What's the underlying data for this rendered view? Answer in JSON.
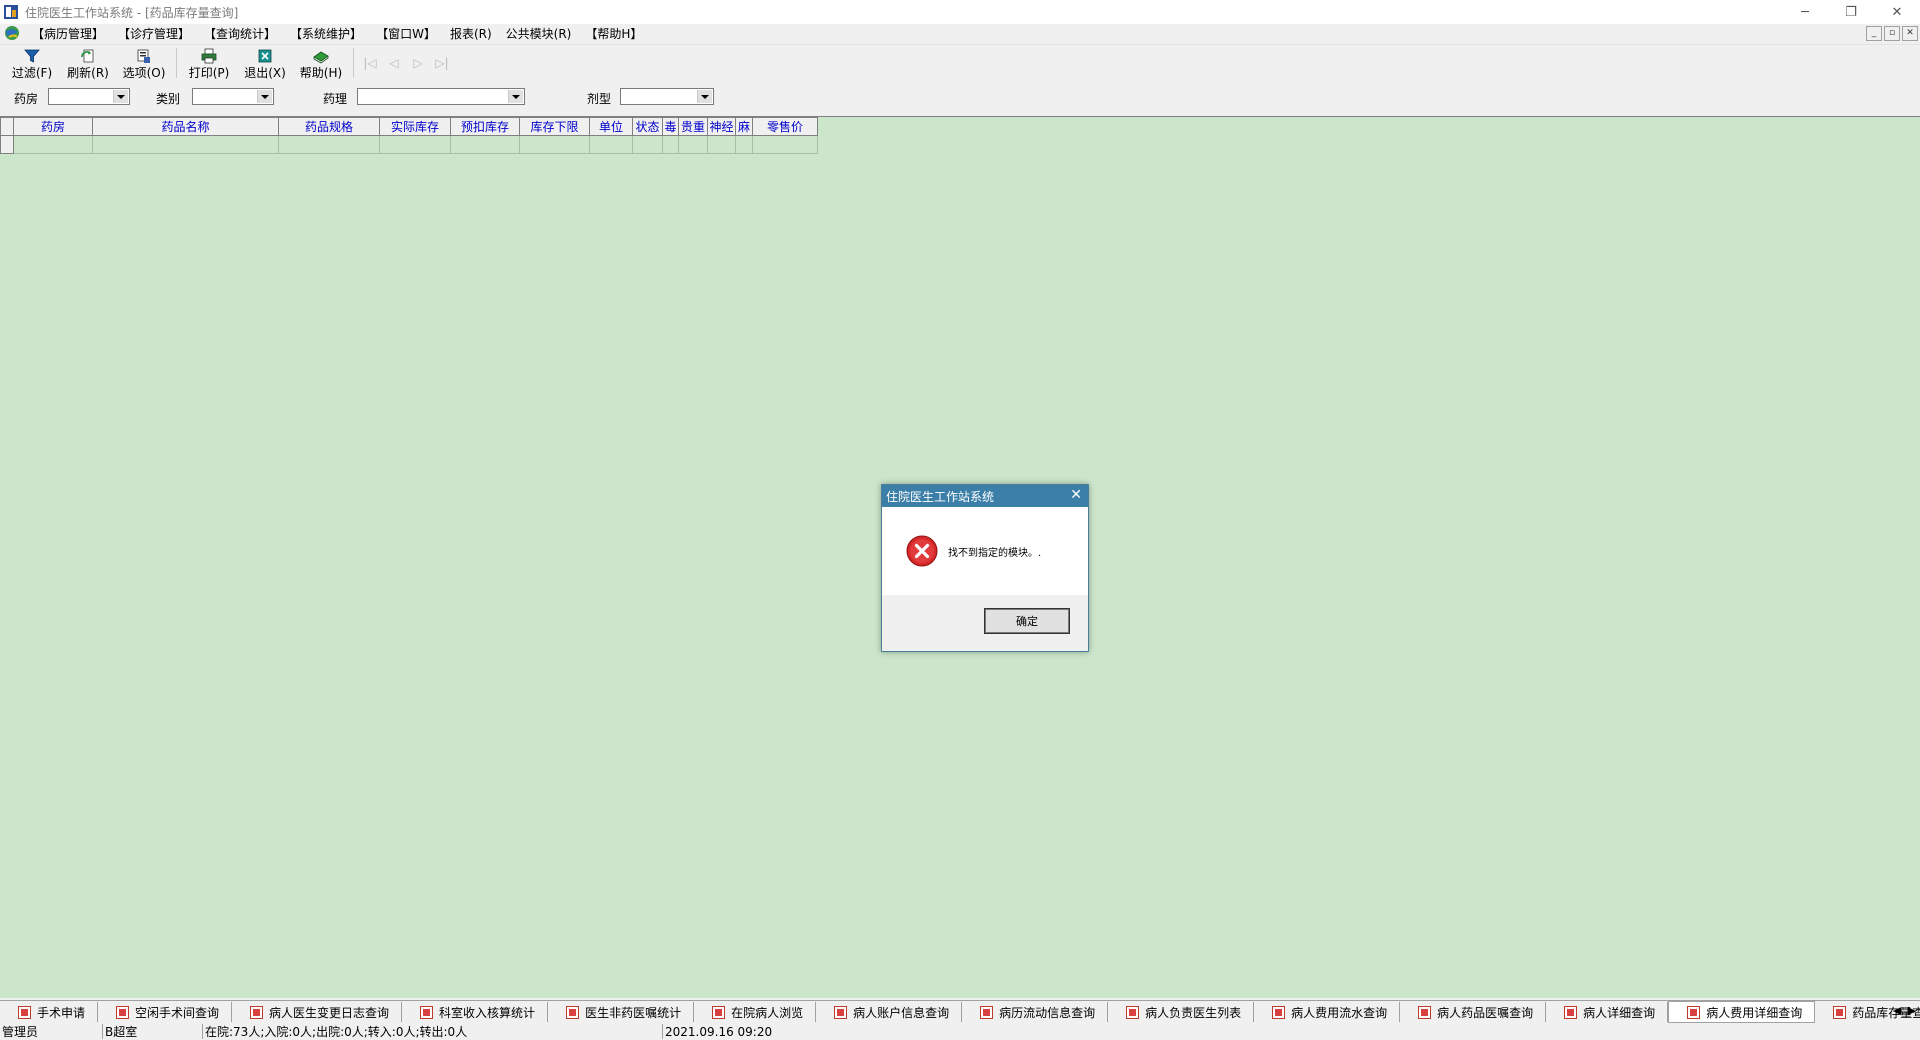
{
  "window": {
    "title": "住院医生工作站系统 - [药品库存量查询]",
    "minimize": "─",
    "restore": "❐",
    "close": "✕"
  },
  "menu": {
    "items": [
      "【病历管理】",
      "【诊疗管理】",
      "【查询统计】",
      "【系统维护】",
      "【窗口W】",
      "报表(R)",
      "公共模块(R)",
      "【帮助H】"
    ],
    "mdi": [
      "_",
      "▫",
      "✕"
    ]
  },
  "toolbar": {
    "filter": "过滤(F)",
    "refresh": "刷新(R)",
    "options": "选项(O)",
    "print": "打印(P)",
    "exit": "退出(X)",
    "help": "帮助(H)",
    "nav": [
      "|◁",
      "◁",
      "▷",
      "▷|"
    ]
  },
  "filters": {
    "pharmacy_label": "药房",
    "category_label": "类别",
    "pharmacology_label": "药理",
    "dosage_form_label": "剂型"
  },
  "grid": {
    "columns": [
      "药房",
      "药品名称",
      "药品规格",
      "实际库存",
      "预扣库存",
      "库存下限",
      "单位",
      "状态",
      "毒",
      "贵重",
      "神经",
      "麻",
      "零售价"
    ]
  },
  "dialog": {
    "title": "住院医生工作站系统",
    "close": "✕",
    "message": "找不到指定的模块。.",
    "ok": "确定"
  },
  "taskbar": {
    "tabs": [
      "手术申请",
      "空闲手术间查询",
      "病人医生变更日志查询",
      "科室收入核算统计",
      "医生非药医嘱统计",
      "在院病人浏览",
      "病人账户信息查询",
      "病历流动信息查询",
      "病人负责医生列表",
      "病人费用流水查询",
      "病人药品医嘱查询",
      "病人详细查询",
      "病人费用详细查询",
      "药品库存量查询"
    ],
    "active_index": 12,
    "scroll_left": "◀",
    "scroll_right": "▶"
  },
  "status": {
    "user": "管理员",
    "department": "B超室",
    "summary": "在院:73人;入院:0人;出院:0人;转入:0人;转出:0人",
    "datetime": "2021.09.16 09:20"
  },
  "colors": {
    "grid_background": "#cce6cc",
    "header_text": "#0000cc",
    "dialog_title": "#3b7ea8",
    "error_icon": "#d62828"
  }
}
